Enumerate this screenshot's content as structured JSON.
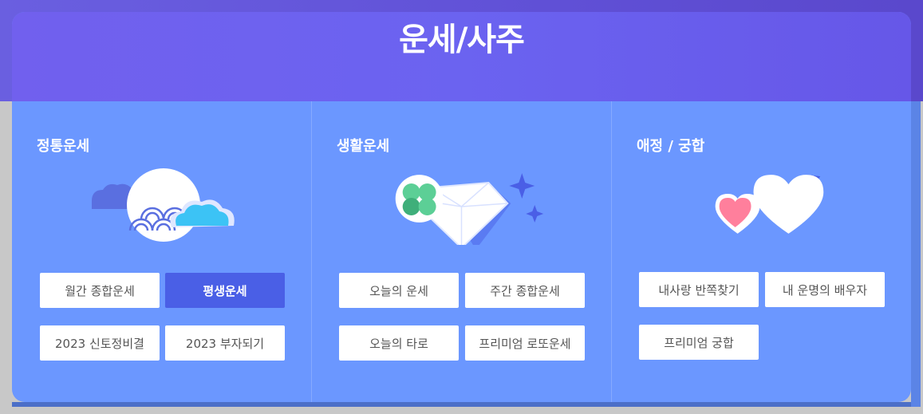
{
  "header": {
    "title": "운세/사주"
  },
  "sections": [
    {
      "title": "정통운세",
      "illustration": "moon-cloud-icon",
      "buttons": [
        {
          "label": "월간 종합운세",
          "active": false
        },
        {
          "label": "평생운세",
          "active": true
        },
        {
          "label": "2023 신토정비결",
          "active": false
        },
        {
          "label": "2023 부자되기",
          "active": false
        }
      ]
    },
    {
      "title": "생활운세",
      "illustration": "clover-diamond-icon",
      "buttons": [
        {
          "label": "오늘의 운세",
          "active": false
        },
        {
          "label": "주간 종합운세",
          "active": false
        },
        {
          "label": "오늘의 타로",
          "active": false
        },
        {
          "label": "프리미엄 로또운세",
          "active": false
        }
      ]
    },
    {
      "title": "애정 / 궁합",
      "illustration": "hearts-arrow-icon",
      "buttons": [
        {
          "label": "내사랑 반쪽찾기",
          "active": false
        },
        {
          "label": "내 운명의 배우자",
          "active": false
        },
        {
          "label": "프리미엄 궁합",
          "active": false
        }
      ]
    }
  ],
  "colors": {
    "header_bg": "#6b63f0",
    "card_bg": "#6b97ff",
    "active_button": "#4a5fe6",
    "button_bg": "#ffffff"
  }
}
